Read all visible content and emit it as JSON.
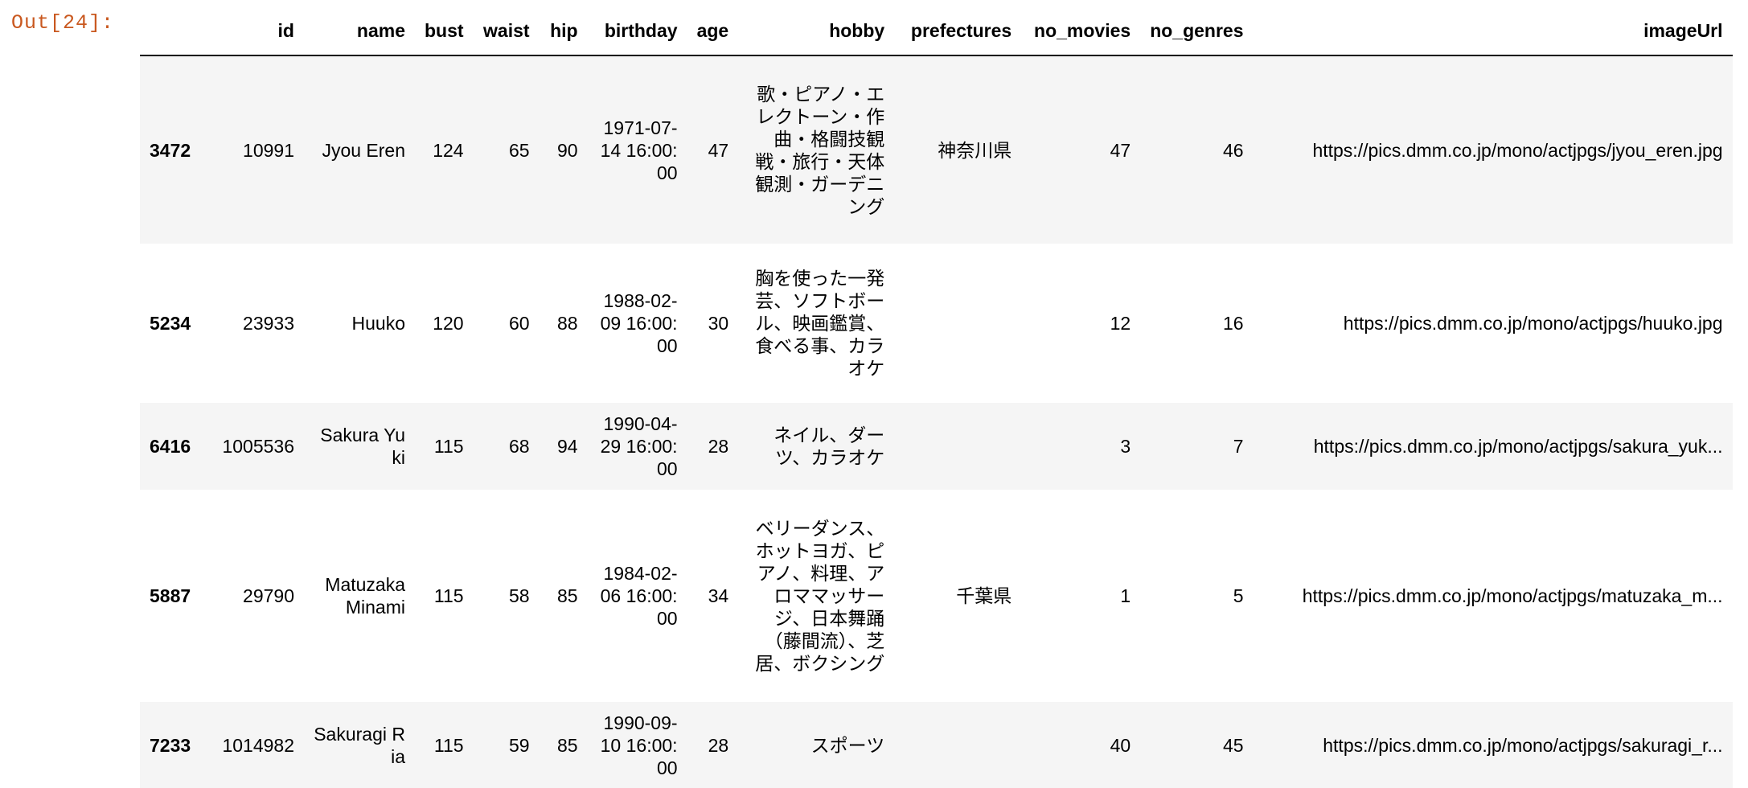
{
  "prompt": "Out[24]:",
  "columns": [
    "",
    "id",
    "name",
    "bust",
    "waist",
    "hip",
    "birthday",
    "age",
    "hobby",
    "prefectures",
    "no_movies",
    "no_genres",
    "imageUrl"
  ],
  "rows": [
    {
      "index": "3472",
      "id": "10991",
      "name": "Jyou Eren",
      "bust": "124",
      "waist": "65",
      "hip": "90",
      "birthday": "1971-07-14 16:00:00",
      "age": "47",
      "hobby": "歌・ピアノ・エレクトーン・作曲・格闘技観戦・旅行・天体観測・ガーデニング",
      "prefectures": "神奈川県",
      "no_movies": "47",
      "no_genres": "46",
      "imageUrl": "https://pics.dmm.co.jp/mono/actjpgs/jyou_eren.jpg"
    },
    {
      "index": "5234",
      "id": "23933",
      "name": "Huuko",
      "bust": "120",
      "waist": "60",
      "hip": "88",
      "birthday": "1988-02-09 16:00:00",
      "age": "30",
      "hobby": "胸を使った一発芸、ソフトボール、映画鑑賞、食べる事、カラオケ",
      "prefectures": "",
      "no_movies": "12",
      "no_genres": "16",
      "imageUrl": "https://pics.dmm.co.jp/mono/actjpgs/huuko.jpg"
    },
    {
      "index": "6416",
      "id": "1005536",
      "name": "Sakura Yuki",
      "bust": "115",
      "waist": "68",
      "hip": "94",
      "birthday": "1990-04-29 16:00:00",
      "age": "28",
      "hobby": "ネイル、ダーツ、カラオケ",
      "prefectures": "",
      "no_movies": "3",
      "no_genres": "7",
      "imageUrl": "https://pics.dmm.co.jp/mono/actjpgs/sakura_yuk..."
    },
    {
      "index": "5887",
      "id": "29790",
      "name": "Matuzaka Minami",
      "bust": "115",
      "waist": "58",
      "hip": "85",
      "birthday": "1984-02-06 16:00:00",
      "age": "34",
      "hobby": "ベリーダンス、ホットヨガ、ピアノ、料理、アロママッサージ、日本舞踊（藤間流）、芝居、ボクシング",
      "prefectures": "千葉県",
      "no_movies": "1",
      "no_genres": "5",
      "imageUrl": "https://pics.dmm.co.jp/mono/actjpgs/matuzaka_m..."
    },
    {
      "index": "7233",
      "id": "1014982",
      "name": "Sakuragi Ria",
      "bust": "115",
      "waist": "59",
      "hip": "85",
      "birthday": "1990-09-10 16:00:00",
      "age": "28",
      "hobby": "スポーツ",
      "prefectures": "",
      "no_movies": "40",
      "no_genres": "45",
      "imageUrl": "https://pics.dmm.co.jp/mono/actjpgs/sakuragi_r..."
    }
  ]
}
